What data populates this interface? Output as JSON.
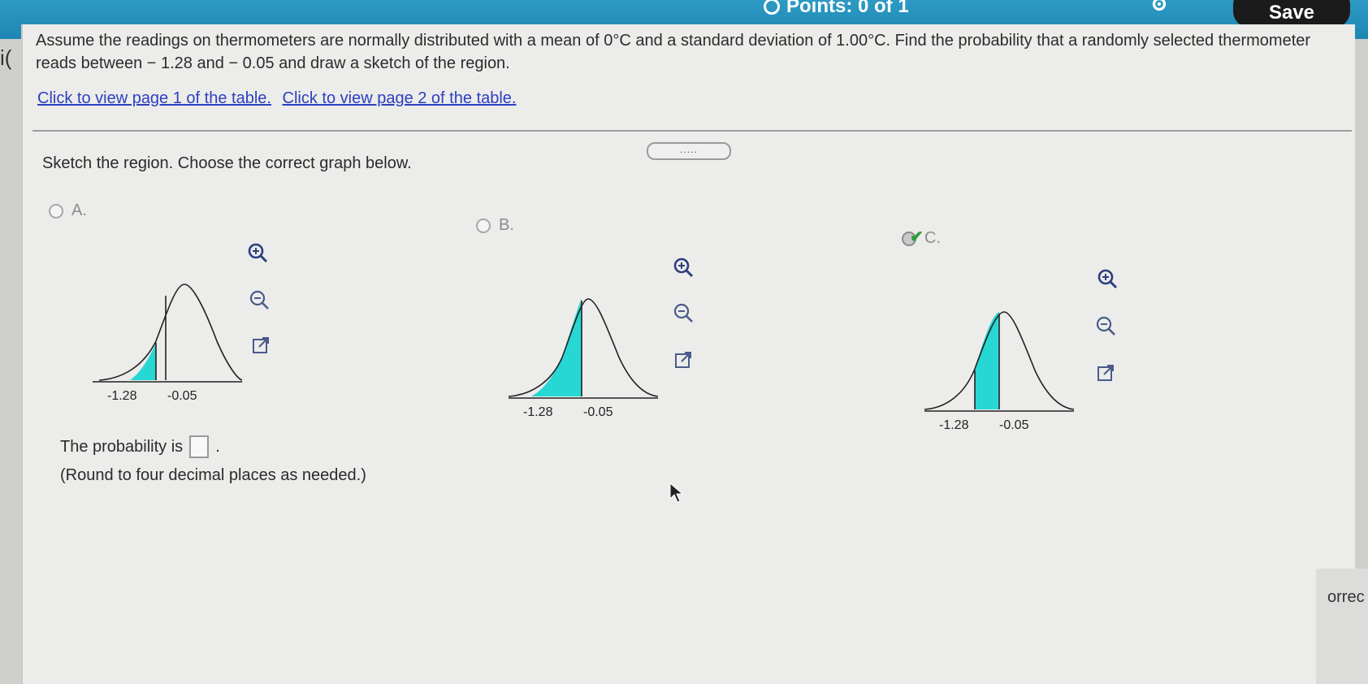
{
  "header": {
    "points_text": "Points: 0 of 1",
    "save_label": "Save"
  },
  "question": {
    "text": "Assume the readings on thermometers are normally distributed with a mean of 0°C and a standard deviation of 1.00°C. Find the probability that a randomly selected thermometer reads between − 1.28 and − 0.05 and draw a sketch of the region.",
    "links": [
      "Click to view page 1 of the table.",
      "Click to view page 2 of the table."
    ],
    "more_dots": "....."
  },
  "prompt": "Sketch the region. Choose the correct graph below.",
  "options": [
    {
      "label": "A.",
      "tick_labels": [
        "-1.28",
        "-0.05"
      ],
      "selected": false
    },
    {
      "label": "B.",
      "tick_labels": [
        "-1.28",
        "-0.05"
      ],
      "selected": false
    },
    {
      "label": "C.",
      "tick_labels": [
        "-1.28",
        "-0.05"
      ],
      "selected": true
    }
  ],
  "answer": {
    "label": "The probability is",
    "trailing": ".",
    "value": "",
    "note": "(Round to four decimal places as needed.)"
  },
  "edge_text": {
    "left": "i(",
    "right": "orrec"
  },
  "colors": {
    "shade": "#27d7d4",
    "header": "#1f86b3",
    "check": "#2a9d3a"
  },
  "icons": [
    "zoom-in-icon",
    "zoom-out-icon",
    "popout-icon",
    "gear-icon"
  ]
}
